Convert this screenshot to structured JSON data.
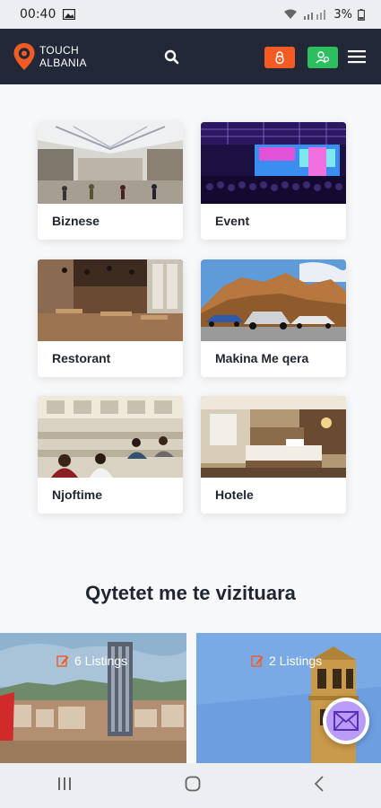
{
  "status_bar": {
    "time": "00:40",
    "battery": "3%"
  },
  "header": {
    "logo_line1": "TOUCH",
    "logo_line2": "ALBANIA"
  },
  "categories": [
    {
      "label": "Biznese"
    },
    {
      "label": "Event"
    },
    {
      "label": "Restorant"
    },
    {
      "label": "Makina Me qera"
    },
    {
      "label": "Njoftime"
    },
    {
      "label": "Hotele"
    }
  ],
  "cities": {
    "title": "Qytetet me te vizituara",
    "items": [
      {
        "count_label": "6 Listings"
      },
      {
        "count_label": "2 Listings"
      }
    ]
  },
  "colors": {
    "navbar": "#232838",
    "accent_orange": "#f25c24",
    "accent_green": "#2dbe60",
    "fab": "#b99cf7"
  }
}
